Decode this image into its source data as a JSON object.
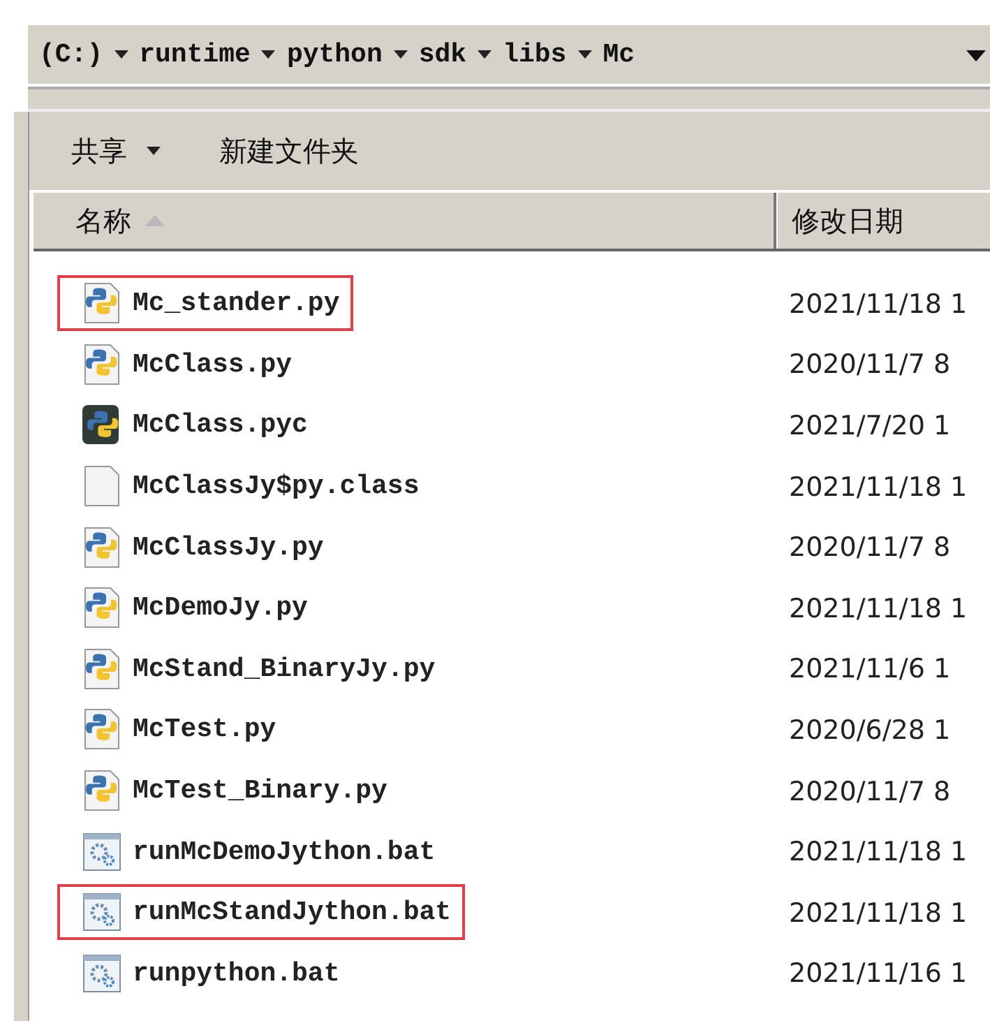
{
  "address_bar": {
    "segments": [
      "(C:)",
      "runtime",
      "python",
      "sdk",
      "libs",
      "Mc"
    ]
  },
  "toolbar": {
    "buttons": [
      {
        "label": "共享",
        "dropdown": true
      },
      {
        "label": "新建文件夹",
        "dropdown": false
      }
    ]
  },
  "table": {
    "columns": [
      {
        "label": "名称",
        "sorted": true
      },
      {
        "label": "修改日期",
        "sorted": false
      }
    ],
    "rows": [
      {
        "name": "Mc_stander.py",
        "date": "2021/11/18 1",
        "kind": "py",
        "marked": true
      },
      {
        "name": "McClass.py",
        "date": "2020/11/7 8",
        "kind": "py",
        "marked": false
      },
      {
        "name": "McClass.pyc",
        "date": "2021/7/20 1",
        "kind": "pyc",
        "marked": false
      },
      {
        "name": "McClassJy$py.class",
        "date": "2021/11/18 1",
        "kind": "file",
        "marked": false
      },
      {
        "name": "McClassJy.py",
        "date": "2020/11/7 8",
        "kind": "py",
        "marked": false
      },
      {
        "name": "McDemoJy.py",
        "date": "2021/11/18 1",
        "kind": "py",
        "marked": false
      },
      {
        "name": "McStand_BinaryJy.py",
        "date": "2021/11/6 1",
        "kind": "py",
        "marked": false
      },
      {
        "name": "McTest.py",
        "date": "2020/6/28 1",
        "kind": "py",
        "marked": false
      },
      {
        "name": "McTest_Binary.py",
        "date": "2020/11/7 8",
        "kind": "py",
        "marked": false
      },
      {
        "name": "runMcDemoJython.bat",
        "date": "2021/11/18 1",
        "kind": "bat",
        "marked": false
      },
      {
        "name": "runMcStandJython.bat",
        "date": "2021/11/18 1",
        "kind": "bat",
        "marked": true
      },
      {
        "name": "runpython.bat",
        "date": "2021/11/16 1",
        "kind": "bat",
        "marked": false
      }
    ]
  }
}
